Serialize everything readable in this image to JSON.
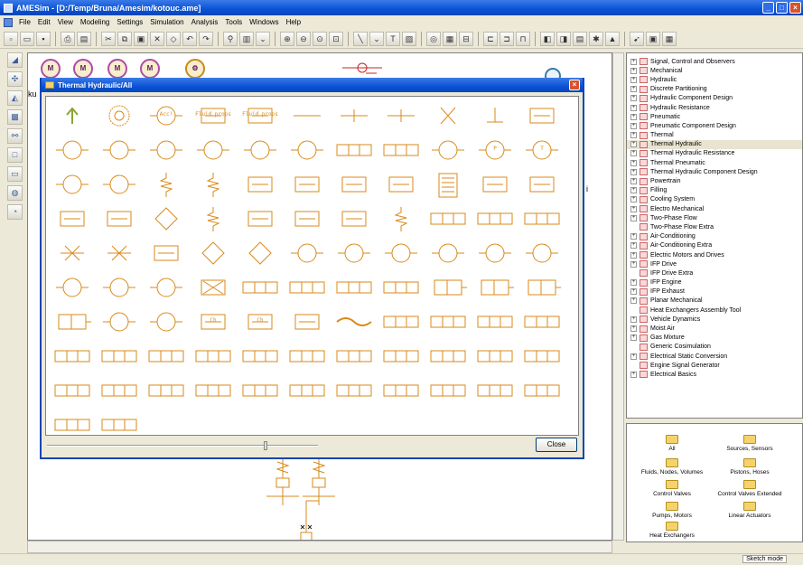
{
  "window": {
    "title": "AMESim - [D:/Temp/Bruna/Amesim/kotouc.ame]"
  },
  "menu": [
    "File",
    "Edit",
    "View",
    "Modeling",
    "Settings",
    "Simulation",
    "Analysis",
    "Tools",
    "Windows",
    "Help"
  ],
  "canvas": {
    "partial_label": "ku",
    "right_edge_label": "i"
  },
  "dialog": {
    "title": "Thermal Hydraulic/All",
    "close_button": "Close",
    "symbol_text": {
      "acc": "Acc!",
      "fluid_props": "Fluid props",
      "ch": "Ch",
      "p": "P",
      "t": "T",
      "ts": "TS"
    }
  },
  "tree": {
    "items": [
      {
        "label": "Signal, Control and Observers",
        "expand": "+"
      },
      {
        "label": "Mechanical",
        "expand": "+"
      },
      {
        "label": "Hydraulic",
        "expand": "+"
      },
      {
        "label": "Discrete Partitioning",
        "expand": "+"
      },
      {
        "label": "Hydraulic Component Design",
        "expand": "+"
      },
      {
        "label": "Hydraulic Resistance",
        "expand": "+"
      },
      {
        "label": "Pneumatic",
        "expand": "+"
      },
      {
        "label": "Pneumatic Component Design",
        "expand": "+"
      },
      {
        "label": "Thermal",
        "expand": "+"
      },
      {
        "label": "Thermal Hydraulic",
        "expand": "+",
        "selected": true
      },
      {
        "label": "Thermal Hydraulic Resistance",
        "expand": "+"
      },
      {
        "label": "Thermal Pneumatic",
        "expand": "+"
      },
      {
        "label": "Thermal Hydraulic Component Design",
        "expand": "+"
      },
      {
        "label": "Powertrain",
        "expand": "+"
      },
      {
        "label": "Filling",
        "expand": "+"
      },
      {
        "label": "Cooling System",
        "expand": "+"
      },
      {
        "label": "Electro Mechanical",
        "expand": "+"
      },
      {
        "label": "Two-Phase Flow",
        "expand": "+"
      },
      {
        "label": "Two-Phase Flow Extra",
        "expand": ""
      },
      {
        "label": "Air-Conditioning",
        "expand": "+"
      },
      {
        "label": "Air-Conditioning Extra",
        "expand": "+"
      },
      {
        "label": "Electric Motors and Drives",
        "expand": "+"
      },
      {
        "label": "IFP Drive",
        "expand": "+"
      },
      {
        "label": "IFP Drive Extra",
        "expand": ""
      },
      {
        "label": "IFP Engine",
        "expand": "+"
      },
      {
        "label": "IFP Exhaust",
        "expand": "+"
      },
      {
        "label": "Planar Mechanical",
        "expand": "+"
      },
      {
        "label": "Heat Exchangers Assembly Tool",
        "expand": ""
      },
      {
        "label": "Vehicle Dynamics",
        "expand": "+"
      },
      {
        "label": "Moist Air",
        "expand": "+"
      },
      {
        "label": "Gas Mixture",
        "expand": "+"
      },
      {
        "label": "Generic Cosimulation",
        "expand": ""
      },
      {
        "label": "Electrical Static Conversion",
        "expand": "+"
      },
      {
        "label": "Engine Signal Generator",
        "expand": ""
      },
      {
        "label": "Electrical Basics",
        "expand": "+"
      }
    ]
  },
  "palette": {
    "folders": [
      "All",
      "Sources, Sensors",
      "Fluids, Nodes, Volumes",
      "Pistons, Hoses",
      "Control Valves",
      "Control Valves Extended",
      "Pumps, Motors",
      "Linear Actuators",
      "Heat Exchangers"
    ]
  },
  "status": {
    "mode": "Sketch mode"
  },
  "colors": {
    "title_blue": "#0a52d6",
    "symbol_orange": "#d98a1a",
    "selection": "#e8e4d0"
  }
}
